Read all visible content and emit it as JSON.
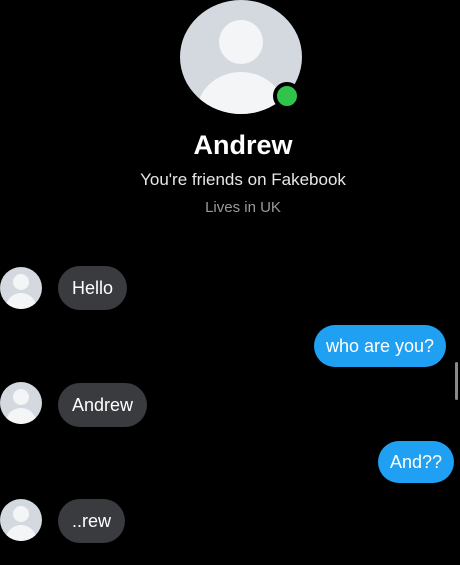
{
  "contact": {
    "name": "Andrew",
    "friends_text": "You're friends on Fakebook",
    "location_text": "Lives in UK",
    "status": "online",
    "status_color": "#31c34a"
  },
  "messages": [
    {
      "direction": "incoming",
      "text": "Hello"
    },
    {
      "direction": "outgoing",
      "text": "who are you?"
    },
    {
      "direction": "incoming",
      "text": "Andrew"
    },
    {
      "direction": "outgoing",
      "text": "And??"
    },
    {
      "direction": "incoming",
      "text": "..rew"
    }
  ],
  "colors": {
    "background": "#000000",
    "incoming_bubble": "#3a3b3f",
    "outgoing_bubble": "#1fa0f2"
  }
}
